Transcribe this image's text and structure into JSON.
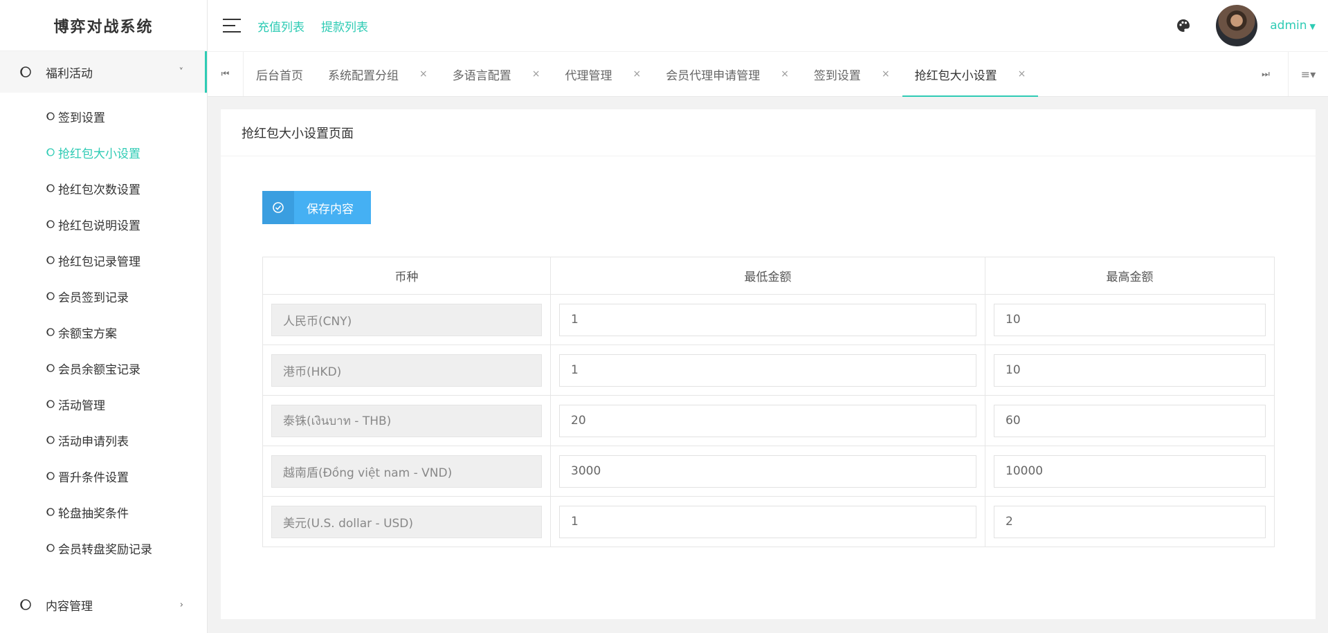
{
  "app": {
    "title": "博弈对战系统"
  },
  "sidebar": {
    "group": {
      "label": "福利活动",
      "arrow": "˅"
    },
    "items": [
      {
        "label": "签到设置",
        "active": false
      },
      {
        "label": "抢红包大小设置",
        "active": true
      },
      {
        "label": "抢红包次数设置",
        "active": false
      },
      {
        "label": "抢红包说明设置",
        "active": false
      },
      {
        "label": "抢红包记录管理",
        "active": false
      },
      {
        "label": "会员签到记录",
        "active": false
      },
      {
        "label": "余额宝方案",
        "active": false
      },
      {
        "label": "会员余额宝记录",
        "active": false
      },
      {
        "label": "活动管理",
        "active": false
      },
      {
        "label": "活动申请列表",
        "active": false
      },
      {
        "label": "晋升条件设置",
        "active": false
      },
      {
        "label": "轮盘抽奖条件",
        "active": false
      },
      {
        "label": "会员转盘奖励记录",
        "active": false
      }
    ],
    "bottom_group": {
      "label": "内容管理",
      "arrow": "›"
    }
  },
  "header": {
    "links": [
      "充值列表",
      "提款列表"
    ],
    "user": "admin",
    "icons": [
      "menu-icon",
      "palette-icon",
      "avatar"
    ]
  },
  "tabs": {
    "items": [
      {
        "label": "后台首页",
        "closable": false,
        "active": false
      },
      {
        "label": "系统配置分组",
        "closable": true,
        "active": false
      },
      {
        "label": "多语言配置",
        "closable": true,
        "active": false
      },
      {
        "label": "代理管理",
        "closable": true,
        "active": false
      },
      {
        "label": "会员代理申请管理",
        "closable": true,
        "active": false
      },
      {
        "label": "签到设置",
        "closable": true,
        "active": false
      },
      {
        "label": "抢红包大小设置",
        "closable": true,
        "active": true
      }
    ],
    "close_glyph": "×",
    "prev_glyph": "⏮",
    "next_glyph": "⏭",
    "menu_glyph": "≡▾"
  },
  "page": {
    "title": "抢红包大小设置页面",
    "save_label": "保存内容",
    "columns": [
      "币种",
      "最低金额",
      "最高金额"
    ],
    "rows": [
      {
        "currency": "人民币(CNY)",
        "min": "1",
        "max": "10"
      },
      {
        "currency": "港币(HKD)",
        "min": "1",
        "max": "10"
      },
      {
        "currency": "泰铢(เงินบาท - THB)",
        "min": "20",
        "max": "60"
      },
      {
        "currency": "越南盾(Đồng việt nam - VND)",
        "min": "3000",
        "max": "10000"
      },
      {
        "currency": "美元(U.S. dollar - USD)",
        "min": "1",
        "max": "2"
      }
    ]
  },
  "colors": {
    "accent": "#2ecbb4",
    "button": "#45b0f3",
    "button_icon_bg": "#3a9ee0"
  }
}
